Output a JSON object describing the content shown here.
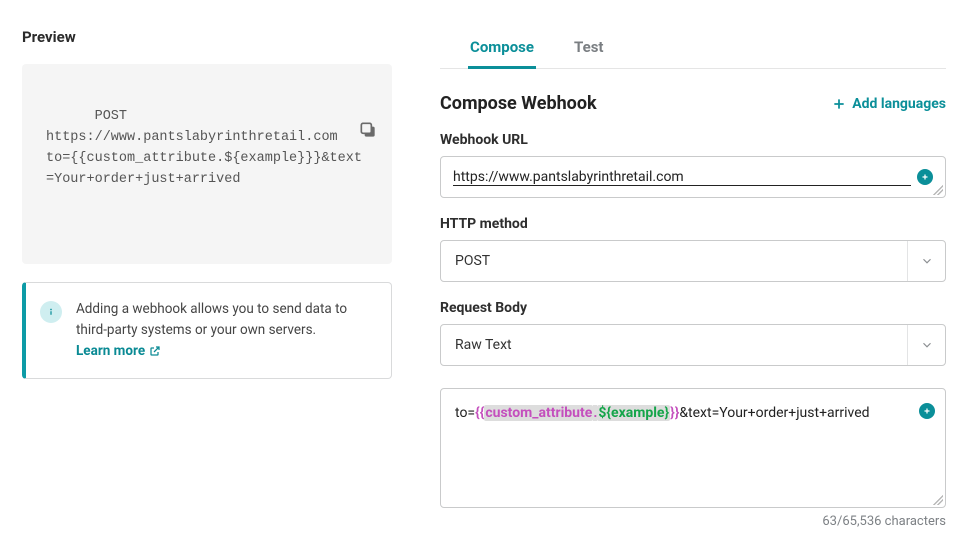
{
  "preview": {
    "title": "Preview",
    "text": "POST\nhttps://www.pantslabyrinthretail.com\nto={{custom_attribute.${example}}}&text=Your+order+just+arrived",
    "info_text": "Adding a webhook allows you to send data to third-party systems or your own servers.  ",
    "learn_more_label": "Learn more"
  },
  "tabs": {
    "compose": "Compose",
    "test": "Test"
  },
  "compose": {
    "header": "Compose Webhook",
    "add_languages_label": "Add languages",
    "webhook_url_label": "Webhook URL",
    "webhook_url_value": "https://www.pantslabyrinthretail.com",
    "http_method_label": "HTTP method",
    "http_method_value": "POST",
    "request_body_label": "Request Body",
    "request_body_type": "Raw Text",
    "body_prefix": "to=",
    "body_brace_open": "{{",
    "body_attr": "custom_attribute",
    "body_dot": ".",
    "body_example": "${example}",
    "body_brace_close": "}}",
    "body_suffix": "&text=Your+order+just+arrived",
    "char_count": "63/65,536 characters"
  }
}
